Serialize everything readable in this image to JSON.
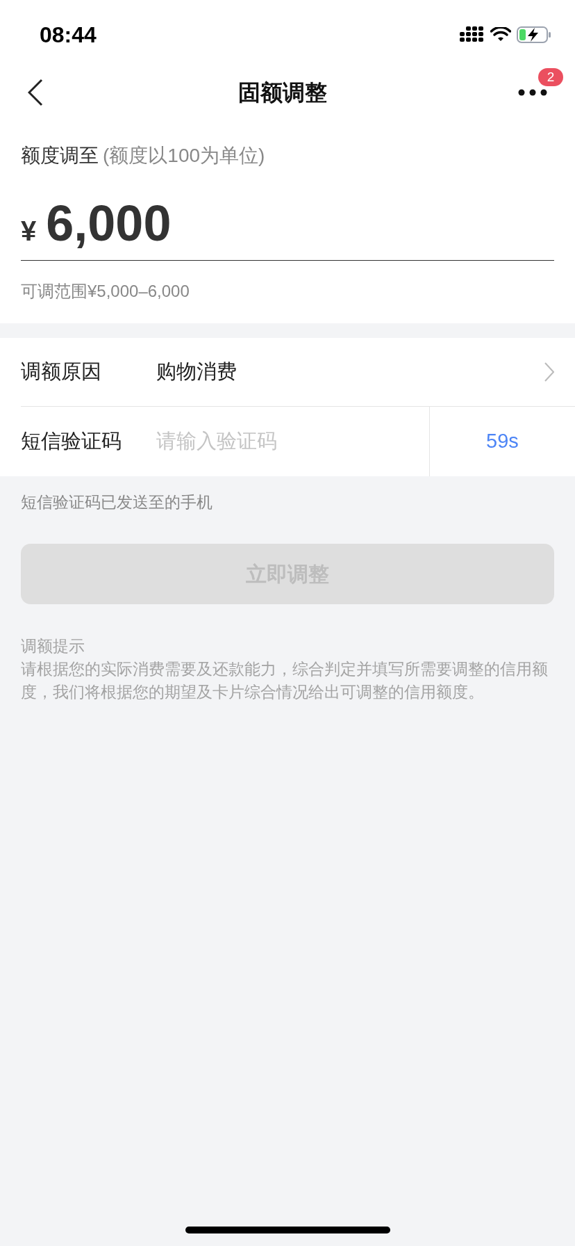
{
  "status_bar": {
    "time": "08:44"
  },
  "nav": {
    "title": "固额调整",
    "badge": "2"
  },
  "amount": {
    "label": "额度调至",
    "note": "(额度以100为单位)",
    "currency": "¥",
    "value": "6,000",
    "range": "可调范围¥5,000–6,000"
  },
  "rows": [
    {
      "kind": "select",
      "label": "调额原因",
      "value": "购物消费"
    },
    {
      "kind": "code",
      "label": "短信验证码",
      "placeholder": "请输入验证码",
      "countdown": "59s"
    }
  ],
  "sms_note": "短信验证码已发送至的手机",
  "submit": {
    "label": "立即调整",
    "disabled": true
  },
  "tips": {
    "title": "调额提示",
    "body": "请根据您的实际消费需要及还款能力，综合判定并填写所需要调整的信用额度，我们将根据您的期望及卡片综合情况给出可调整的信用额度。"
  }
}
